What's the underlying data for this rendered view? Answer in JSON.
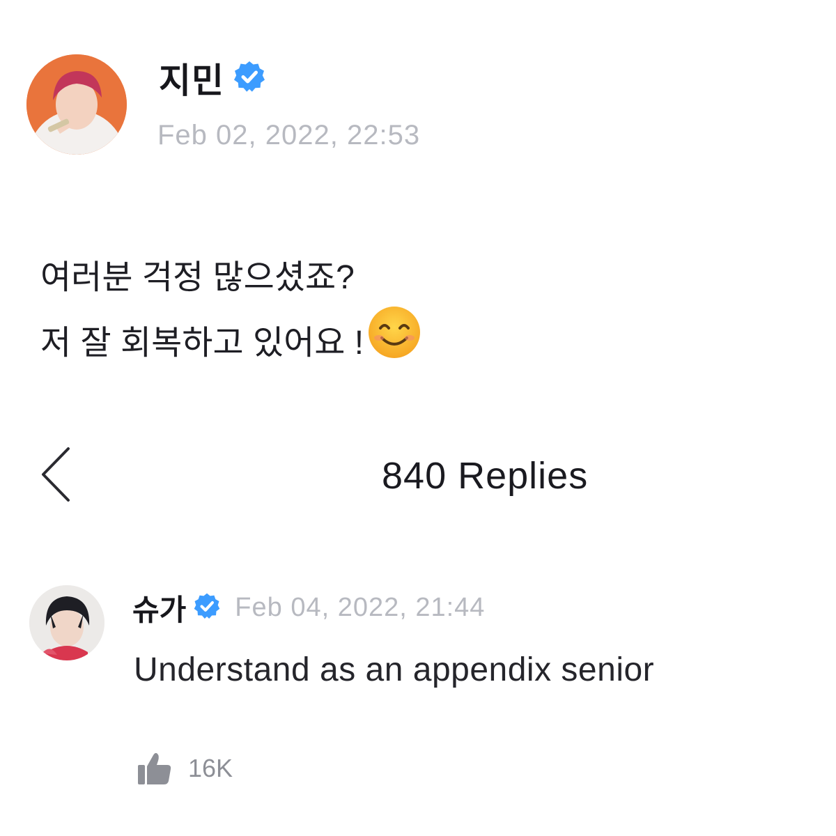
{
  "post": {
    "author": "지민",
    "timestamp": "Feb 02, 2022, 22:53",
    "body_lines": [
      "여러분 걱정 많으셨죠?",
      "저 잘 회복하고 있어요 !"
    ],
    "avatar_bg": "#e9743c"
  },
  "replies_header": {
    "title": "840 Replies"
  },
  "reply": {
    "author": "슈가",
    "timestamp": "Feb 04, 2022, 21:44",
    "text": "Understand as an appendix senior",
    "likes": "16K"
  },
  "colors": {
    "verified": "#3c9cff",
    "meta_text": "#b7b9c0",
    "icon_gray": "#8d8f96"
  },
  "icons": {
    "verified": "verified-badge-icon",
    "back": "chevron-left-icon",
    "like": "thumbs-up-icon",
    "emoji": "smiling-face-emoji-icon"
  }
}
